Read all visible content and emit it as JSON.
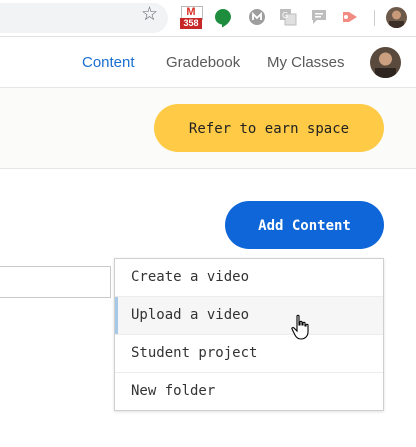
{
  "browser": {
    "star_icon": "star-icon",
    "extensions": [
      {
        "name": "gmail-extension",
        "icon": "gmail-icon",
        "badge": "358",
        "letter": "M"
      },
      {
        "name": "hangouts-extension",
        "icon": "hangouts-icon",
        "color": "#1e8e3e"
      },
      {
        "name": "grey-extension",
        "icon": "grey-circle-icon"
      },
      {
        "name": "translate-extension",
        "icon": "translate-icon"
      },
      {
        "name": "comment-extension",
        "icon": "comment-icon"
      },
      {
        "name": "red-extension",
        "icon": "red-play-icon",
        "color": "#e53935"
      }
    ]
  },
  "nav": {
    "items": [
      {
        "label": "Content",
        "active": true
      },
      {
        "label": "Gradebook",
        "active": false
      },
      {
        "label": "My Classes",
        "active": false
      }
    ]
  },
  "banner": {
    "refer_label": "Refer to earn space",
    "refer_color": "#ffcb47"
  },
  "main": {
    "add_content_label": "Add Content",
    "add_content_color": "#0f66d8",
    "search_value": "",
    "menu": {
      "items": [
        {
          "label": "Create a video",
          "hover": false
        },
        {
          "label": "Upload a video",
          "hover": true
        },
        {
          "label": "Student project",
          "hover": false
        },
        {
          "label": "New folder",
          "hover": false
        }
      ]
    }
  }
}
